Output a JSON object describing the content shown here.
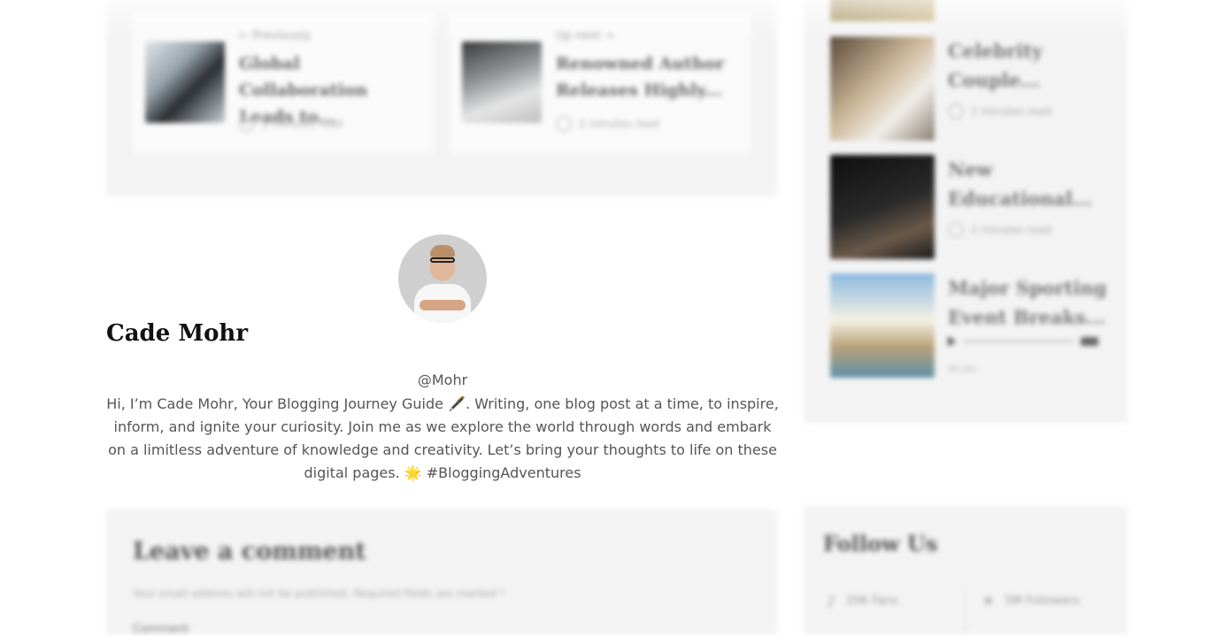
{
  "post_nav": {
    "previous": {
      "label": "← Previously",
      "title": "Global Collaboration Leads to...",
      "read_time": "2 minutes read"
    },
    "next": {
      "label": "Up next →",
      "title": "Renowned Author Releases Highly...",
      "read_time": "2 minutes read"
    }
  },
  "sidebar": {
    "posts": [
      {
        "title": "Celebrity Couple...",
        "read_time": "2 minutes read"
      },
      {
        "title": "New Educational...",
        "read_time": "2 minutes read"
      },
      {
        "title": "Major Sporting Event Breaks...",
        "audio_time": "00:00"
      }
    ],
    "follow": {
      "title": "Follow Us",
      "items": [
        {
          "icon": "tiktok-icon",
          "glyph": "♪",
          "label": "20K Fans"
        },
        {
          "icon": "x-icon",
          "glyph": "✕",
          "label": "5M Followers"
        }
      ]
    }
  },
  "author": {
    "name": "Cade Mohr",
    "handle": "@Mohr",
    "bio": "Hi, I’m Cade Mohr, Your Blogging Journey Guide 🖋️. Writing, one blog post at a time, to inspire, inform, and ignite your curiosity. Join me as we explore the world through words and embark on a limitless adventure of knowledge and creativity. Let’s bring your thoughts to life on these digital pages. 🌟 #BloggingAdventures"
  },
  "comment_form": {
    "title": "Leave a comment",
    "note": "Your email address will not be published. Required fields are marked *",
    "comment_label": "Comment"
  }
}
